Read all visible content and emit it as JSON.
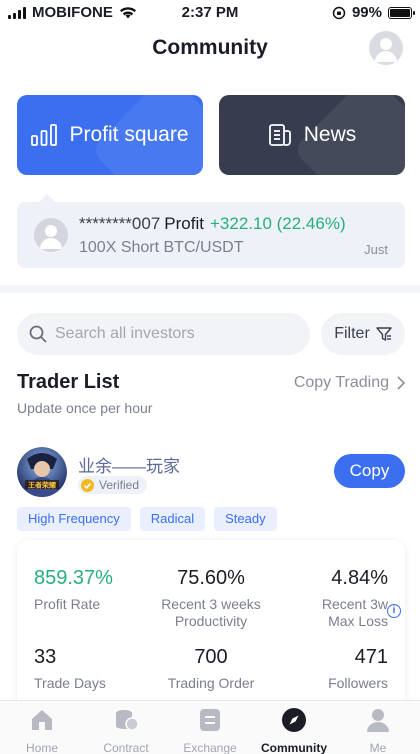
{
  "status_bar": {
    "carrier": "MOBIFONE",
    "time": "2:37 PM",
    "battery": "99%",
    "battery_level": 0.99
  },
  "header": {
    "title": "Community"
  },
  "tiles": [
    {
      "label": "Profit square",
      "icon": "bar-chart-icon",
      "color": "#3b6ff0"
    },
    {
      "label": "News",
      "icon": "news-icon",
      "color": "#373d4f"
    }
  ],
  "ticker": {
    "user": "********007",
    "label": "Profit",
    "gain": "+322.10 (22.46%)",
    "pair": "100X Short BTC/USDT",
    "time": "Just"
  },
  "search": {
    "placeholder": "Search all investors",
    "value": ""
  },
  "filter": {
    "label": "Filter"
  },
  "trader_list": {
    "title": "Trader List",
    "subtitle": "Update once per hour",
    "link": "Copy Trading"
  },
  "trader": {
    "name": "业余——玩家",
    "verified": "Verified",
    "copy_label": "Copy",
    "tags": [
      "High Frequency",
      "Radical",
      "Steady"
    ],
    "stats": {
      "profit_rate": {
        "value": "859.37%",
        "label": "Profit Rate"
      },
      "productivity": {
        "value": "75.60%",
        "label1": "Recent 3 weeks",
        "label2": "Productivity"
      },
      "max_loss": {
        "value": "4.84%",
        "label1": "Recent 3w",
        "label2": "Max Loss"
      },
      "trade_days": {
        "value": "33",
        "label": "Trade Days"
      },
      "trading_order": {
        "value": "700",
        "label": "Trading Order"
      },
      "followers": {
        "value": "471",
        "label": "Followers"
      }
    }
  },
  "tabbar": [
    {
      "label": "Home",
      "icon": "home-icon"
    },
    {
      "label": "Contract",
      "icon": "coins-icon"
    },
    {
      "label": "Exchange",
      "icon": "exchange-icon"
    },
    {
      "label": "Community",
      "icon": "compass-icon",
      "active": true
    },
    {
      "label": "Me",
      "icon": "person-icon"
    }
  ],
  "colors": {
    "accent": "#3b6ff0",
    "positive": "#27b07a",
    "dark_tile": "#373d4f"
  }
}
